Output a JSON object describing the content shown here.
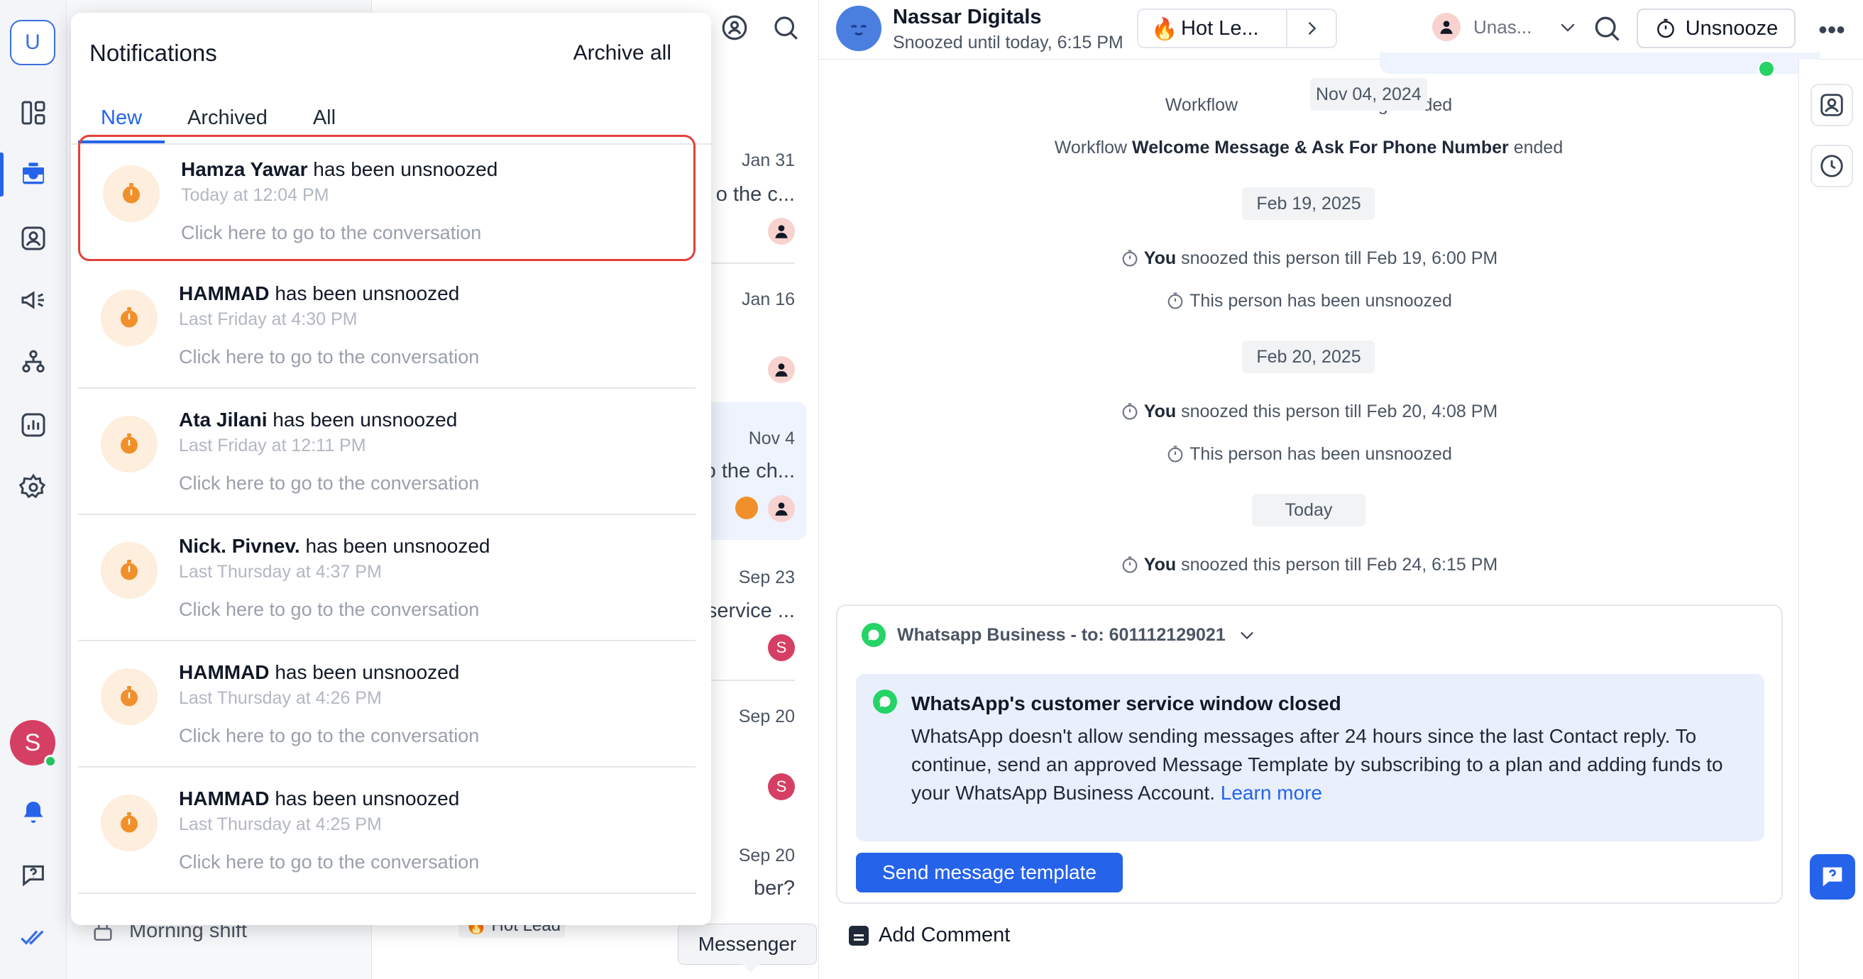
{
  "rail": {
    "logo_letter": "U",
    "avatar_letter": "S"
  },
  "inbox_sidebar": {
    "visible_item": "Morning shift"
  },
  "notifications": {
    "title": "Notifications",
    "archive_all": "Archive all",
    "tabs": [
      {
        "label": "New",
        "active": true
      },
      {
        "label": "Archived",
        "active": false
      },
      {
        "label": "All",
        "active": false
      }
    ],
    "hint": "Click here to go to the conversation",
    "action_suffix": "has been unsnoozed",
    "items": [
      {
        "name": "Hamza Yawar",
        "time": "Today at 12:04 PM"
      },
      {
        "name": "HAMMAD",
        "time": "Last Friday at 4:30 PM"
      },
      {
        "name": "Ata Jilani",
        "time": "Last Friday at 12:11 PM"
      },
      {
        "name": "Nick. Pivnev.",
        "time": "Last Thursday at 4:37 PM"
      },
      {
        "name": "HAMMAD",
        "time": "Last Thursday at 4:26 PM"
      },
      {
        "name": "HAMMAD",
        "time": "Last Thursday at 4:25 PM"
      }
    ]
  },
  "conversation_list": {
    "rows": [
      {
        "date": "Jan 31",
        "snippet": "o the c..."
      },
      {
        "date": "Jan 16",
        "snippet": ""
      },
      {
        "date": "Nov 4",
        "snippet": "o the ch..."
      },
      {
        "date": "Sep 23",
        "snippet": "service ..."
      },
      {
        "date": "Sep 20",
        "snippet": ""
      },
      {
        "date": "Sep 20",
        "snippet": "ber?"
      }
    ],
    "hot_tag": "🔥 Hot Lead",
    "tooltip": "Messenger"
  },
  "header": {
    "name": "Nassar Digitals",
    "status": "Snoozed until today, 6:15 PM",
    "tag": "Hot Le...",
    "tag_emoji": "🔥",
    "assignee": "Unas...",
    "unsnooze": "Unsnooze",
    "more": "•••"
  },
  "timeline": {
    "partial_event_left": "Workflow",
    "partial_event_right": "age ended",
    "floating_date": "Nov 04, 2024",
    "workflow_prefix": "Workflow",
    "workflow_name": "Welcome Message & Ask For Phone Number",
    "workflow_suffix": "ended",
    "date1": "Feb 19, 2025",
    "you": "You",
    "snooze1": "snoozed this person till Feb 19, 6:00 PM",
    "unsnoozed": "This person has been unsnoozed",
    "date2": "Feb 20, 2025",
    "snooze2": "snoozed this person till Feb 20, 4:08 PM",
    "date3": "Today",
    "snooze3": "snoozed this person till Feb 24, 6:15 PM"
  },
  "composer": {
    "channel": "Whatsapp Business - to: 601112129021",
    "notice_title": "WhatsApp's customer service window closed",
    "notice_body": "WhatsApp doesn't allow sending messages after 24 hours since the last Contact reply. To continue, send an approved Message Template by subscribing to a plan and adding funds to your WhatsApp Business Account.",
    "learn_more": "Learn more",
    "send_button": "Send message template"
  },
  "add_comment": "Add Comment",
  "colors": {
    "accent": "#2563eb",
    "snooze_orange": "#f0902b",
    "whatsapp_green": "#25d366",
    "selected_border": "#e2413a"
  }
}
